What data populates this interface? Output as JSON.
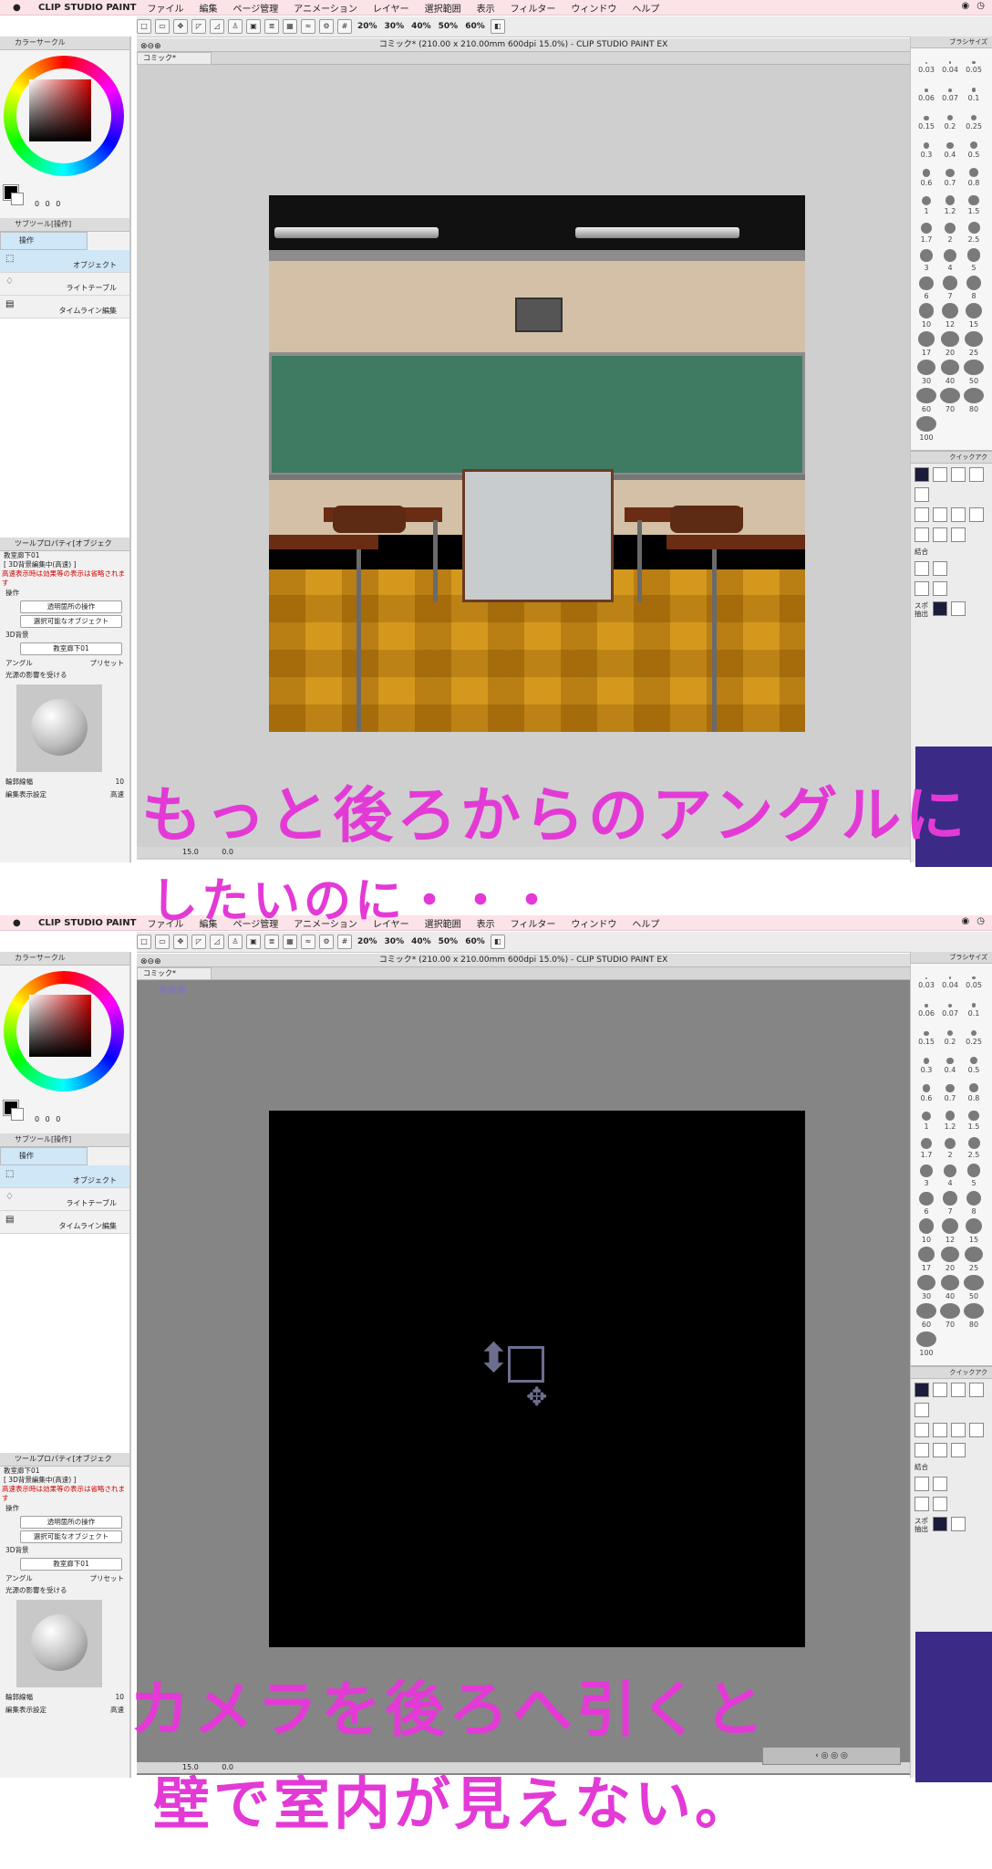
{
  "app": {
    "name": "CLIP STUDIO PAINT",
    "menus": [
      "ファイル",
      "編集",
      "ページ管理",
      "アニメーション",
      "レイヤー",
      "選択範囲",
      "表示",
      "フィルター",
      "ウィンドウ",
      "ヘルプ"
    ]
  },
  "toolbar": {
    "zoom_labels": [
      "20%",
      "30%",
      "40%",
      "50%",
      "60%"
    ]
  },
  "color_panel": {
    "title": "カラーサークル",
    "values": "0 0 0"
  },
  "subtool": {
    "title": "サブツール[操作]",
    "tab": "操作",
    "items": [
      "オブジェクト",
      "ライトテーブル",
      "タイムライン編集"
    ]
  },
  "tool_property": {
    "title": "ツールプロパティ[オブジェク",
    "object_name": "教室廊下01",
    "mode_label": "[ 3D背景編集中(高速) ]",
    "warning": "高速表示時は効果等の表示は省略されます",
    "section_operation": "操作",
    "combo_transparent": "透明箇所の操作",
    "combo_selectable": "選択可能なオブジェクト",
    "section_3d": "3D背景",
    "bg_name": "教室廊下01",
    "angle_label": "アングル",
    "preset_label": "プリセット",
    "light_label": "光源の影響を受ける",
    "outline_label": "輪郭線幅",
    "outline_value": "10",
    "display_label": "編集表示設定",
    "display_value": "高速"
  },
  "canvas": {
    "window_title": "コミック* (210.00 x 210.00mm 600dpi 15.0%) - CLIP STUDIO PAINT EX",
    "tab_label": "コミック*",
    "zoom": "15.0",
    "rotation": "0.0"
  },
  "brush_panel": {
    "title": "ブラシサイズ",
    "sizes": [
      "0.03",
      "0.04",
      "0.05",
      "0.06",
      "0.07",
      "0.1",
      "0.15",
      "0.2",
      "0.25",
      "0.3",
      "0.4",
      "0.5",
      "0.6",
      "0.7",
      "0.8",
      "1",
      "1.2",
      "1.5",
      "1.7",
      "2",
      "2.5",
      "3",
      "4",
      "5",
      "6",
      "7",
      "8",
      "10",
      "12",
      "15",
      "17",
      "20",
      "25",
      "30",
      "40",
      "50",
      "60",
      "70",
      "80",
      "100"
    ]
  },
  "quick_access": {
    "title": "クイックアク",
    "labels": [
      "結合",
      "スポ 抽出"
    ]
  },
  "annotations": {
    "top_line1": "もっと後ろからのアングルに",
    "top_line2": "したいのに・・・",
    "bottom_line1": "カメラを後ろへ引くと",
    "bottom_line2": "壁で室内が見えない。"
  },
  "colors": {
    "menubar": "#fbe3e8",
    "annotation": "#e33ad6",
    "blackboard": "#3f7a62",
    "floor": "#c98a16"
  }
}
